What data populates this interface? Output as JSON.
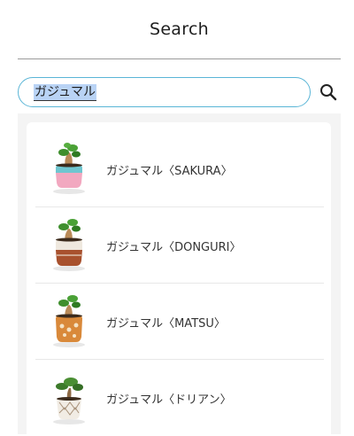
{
  "header": {
    "title": "Search"
  },
  "search": {
    "query": "ガジュマル"
  },
  "results": [
    {
      "label": "ガジュマル〈SAKURA〉",
      "pot": "pink-blue-pot"
    },
    {
      "label": "ガジュマル〈DONGURI〉",
      "pot": "white-brown-pot"
    },
    {
      "label": "ガジュマル〈MATSU〉",
      "pot": "orange-pattern-pot"
    },
    {
      "label": "ガジュマル〈ドリアン〉",
      "pot": "white-lattice-pot"
    }
  ],
  "colors": {
    "accent": "#5ab5d6",
    "selection": "#b9d3f5"
  },
  "icons": {
    "search": "magnifier-icon"
  }
}
